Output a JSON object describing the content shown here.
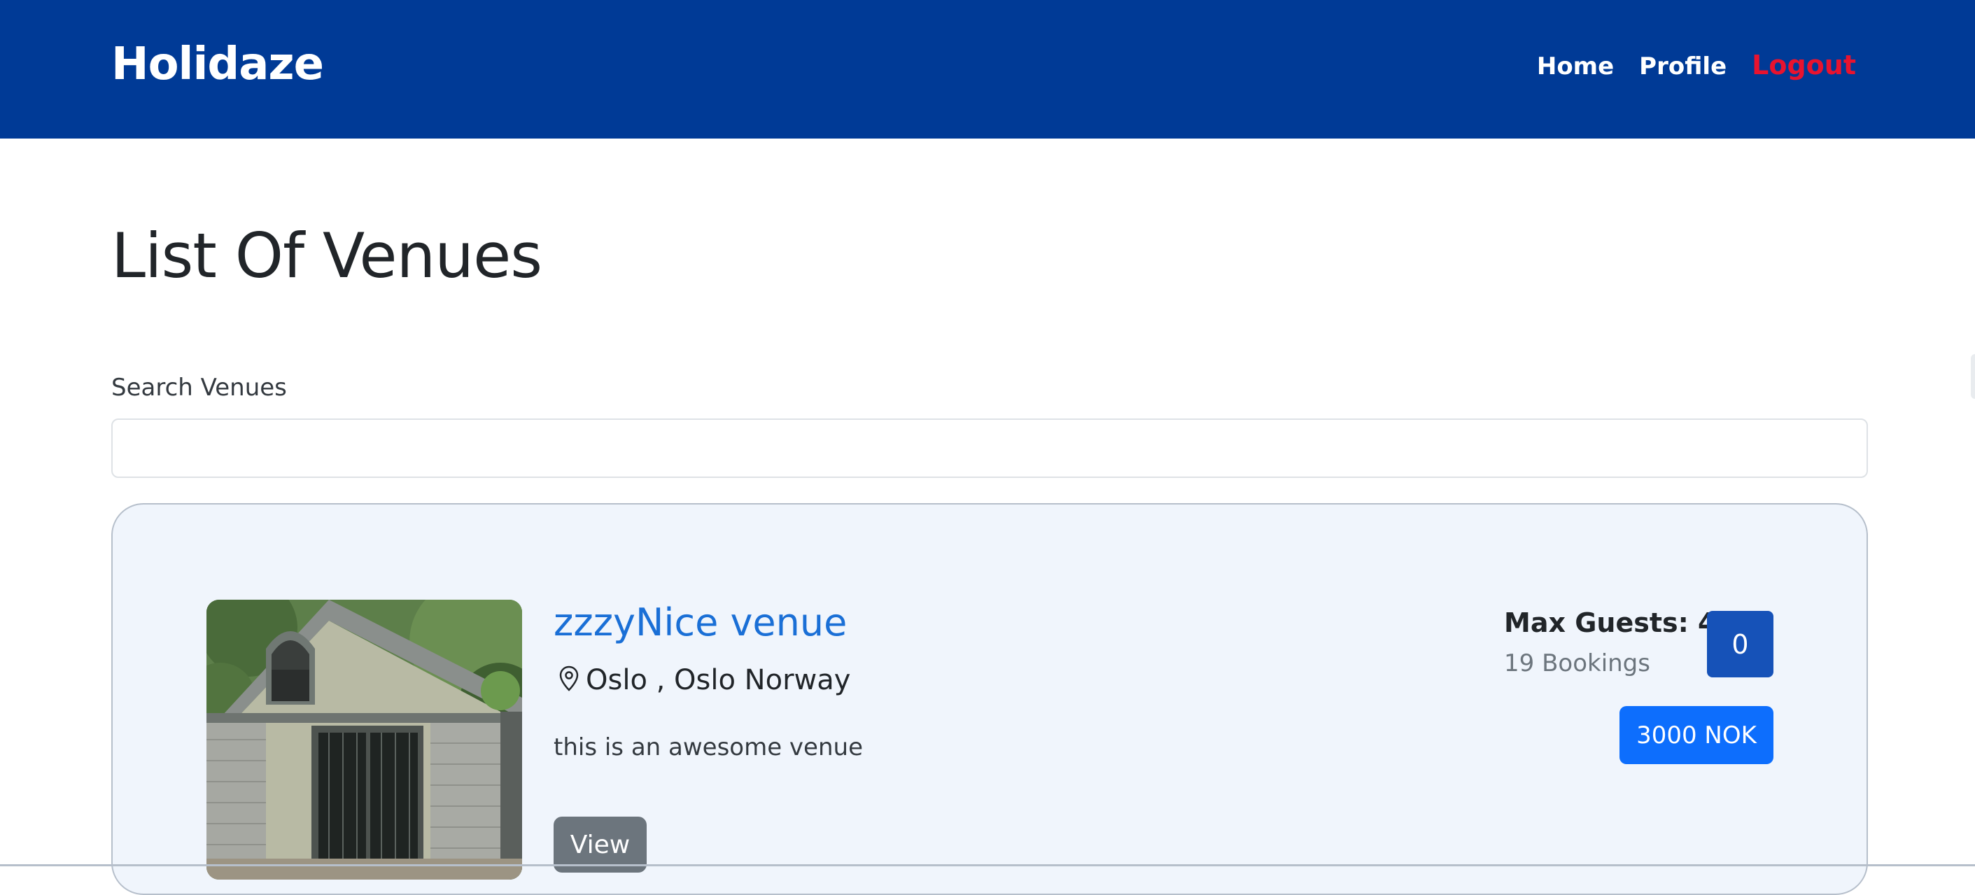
{
  "header": {
    "brand": "Holidaze",
    "nav": {
      "home": "Home",
      "profile": "Profile",
      "logout": "Logout"
    }
  },
  "main": {
    "title": "List Of Venues",
    "search": {
      "label": "Search Venues",
      "value": "",
      "placeholder": ""
    },
    "venues": [
      {
        "name": "zzzyNice venue",
        "location": "Oslo , Oslo Norway",
        "description": "this is an awesome venue",
        "view_label": "View",
        "max_guests_text": "Max Guests: 4",
        "bookings_text": "19 Bookings",
        "badge_value": "0",
        "price_text": "3000 NOK",
        "image_icon": "venue-house-photo"
      }
    ]
  },
  "colors": {
    "header_bg": "#003a96",
    "logout": "#e8132f",
    "venue_link": "#1a6fd6",
    "card_bg": "#f0f5fc",
    "badge_dark": "#1652b8",
    "badge_price": "#0d6efd",
    "button_gray": "#6c757d"
  },
  "icons": {
    "location": "geo-pin-icon"
  }
}
